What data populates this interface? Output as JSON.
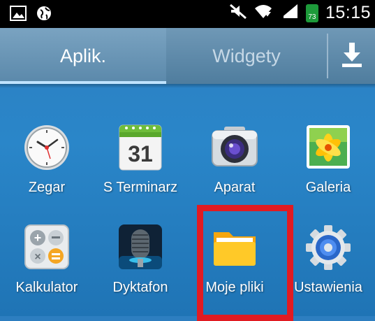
{
  "status_bar": {
    "time": "15:15",
    "battery_level": "73",
    "icons": [
      "gallery-notification-icon",
      "globe-icon",
      "mute-icon",
      "wifi-icon",
      "signal-icon",
      "battery-icon"
    ]
  },
  "tabs": {
    "apps_label": "Aplik.",
    "widgets_label": "Widgety",
    "active": "Aplik.",
    "download_icon": "download-icon"
  },
  "apps": [
    {
      "label": "Zegar",
      "icon": "clock-icon"
    },
    {
      "label": "S Terminarz",
      "icon": "calendar-icon",
      "icon_text": "31"
    },
    {
      "label": "Aparat",
      "icon": "camera-icon"
    },
    {
      "label": "Galeria",
      "icon": "gallery-icon"
    },
    {
      "label": "Kalkulator",
      "icon": "calculator-icon"
    },
    {
      "label": "Dyktafon",
      "icon": "microphone-icon"
    },
    {
      "label": "Moje pliki",
      "icon": "folder-icon",
      "highlighted": true
    },
    {
      "label": "Ustawienia",
      "icon": "settings-gear-icon"
    }
  ],
  "colors": {
    "background": "#2a86c9",
    "highlight": "#e11b22",
    "battery": "#1d9a3a"
  }
}
